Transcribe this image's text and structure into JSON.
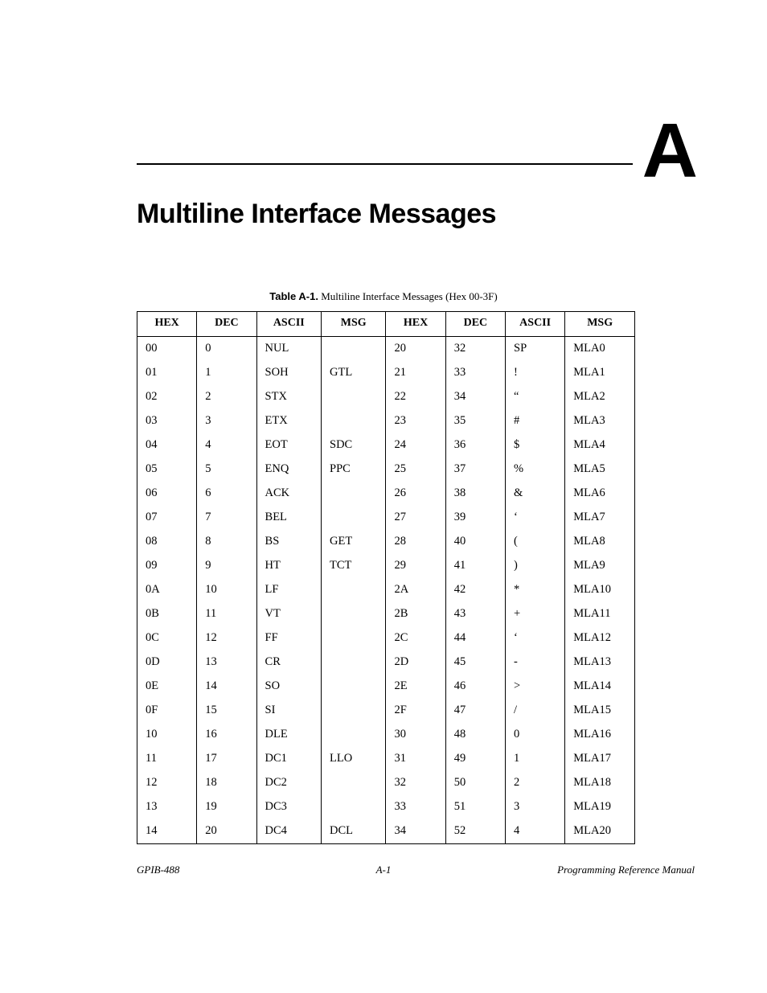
{
  "appendix_letter": "A",
  "page_title": "Multiline Interface Messages",
  "table": {
    "caption_bold": "Table A-1.",
    "caption_rest": "  Multiline Interface Messages (Hex 00-3F)",
    "headers": [
      "HEX",
      "DEC",
      "ASCII",
      "MSG",
      "HEX",
      "DEC",
      "ASCII",
      "MSG"
    ],
    "rows": [
      [
        "00",
        "0",
        "NUL",
        "",
        "20",
        "32",
        "SP",
        "MLA0"
      ],
      [
        "01",
        "1",
        "SOH",
        "GTL",
        "21",
        "33",
        "!",
        "MLA1"
      ],
      [
        "02",
        "2",
        "STX",
        "",
        "22",
        "34",
        "“",
        "MLA2"
      ],
      [
        "03",
        "3",
        "ETX",
        "",
        "23",
        "35",
        "#",
        "MLA3"
      ],
      [
        "04",
        "4",
        "EOT",
        "SDC",
        "24",
        "36",
        "$",
        "MLA4"
      ],
      [
        "05",
        "5",
        "ENQ",
        "PPC",
        "25",
        "37",
        "%",
        "MLA5"
      ],
      [
        "06",
        "6",
        "ACK",
        "",
        "26",
        "38",
        "&",
        "MLA6"
      ],
      [
        "07",
        "7",
        "BEL",
        "",
        "27",
        "39",
        "‘",
        "MLA7"
      ],
      [
        "08",
        "8",
        "BS",
        "GET",
        "28",
        "40",
        "(",
        "MLA8"
      ],
      [
        "09",
        "9",
        "HT",
        "TCT",
        "29",
        "41",
        ")",
        "MLA9"
      ],
      [
        "0A",
        "10",
        "LF",
        "",
        "2A",
        "42",
        "*",
        "MLA10"
      ],
      [
        "0B",
        "11",
        "VT",
        "",
        "2B",
        "43",
        "+",
        "MLA11"
      ],
      [
        "0C",
        "12",
        "FF",
        "",
        "2C",
        "44",
        "‘",
        "MLA12"
      ],
      [
        "0D",
        "13",
        "CR",
        "",
        "2D",
        "45",
        "-",
        "MLA13"
      ],
      [
        "0E",
        "14",
        "SO",
        "",
        "2E",
        "46",
        ">",
        "MLA14"
      ],
      [
        "0F",
        "15",
        "SI",
        "",
        "2F",
        "47",
        "/",
        "MLA15"
      ],
      [
        "10",
        "16",
        "DLE",
        "",
        "30",
        "48",
        "0",
        "MLA16"
      ],
      [
        "11",
        "17",
        "DC1",
        "LLO",
        "31",
        "49",
        "1",
        "MLA17"
      ],
      [
        "12",
        "18",
        "DC2",
        "",
        "32",
        "50",
        "2",
        "MLA18"
      ],
      [
        "13",
        "19",
        "DC3",
        "",
        "33",
        "51",
        "3",
        "MLA19"
      ],
      [
        "14",
        "20",
        "DC4",
        "DCL",
        "34",
        "52",
        "4",
        "MLA20"
      ]
    ]
  },
  "footer": {
    "left": "GPIB-488",
    "center": "A-1",
    "right": "Programming Reference Manual"
  }
}
